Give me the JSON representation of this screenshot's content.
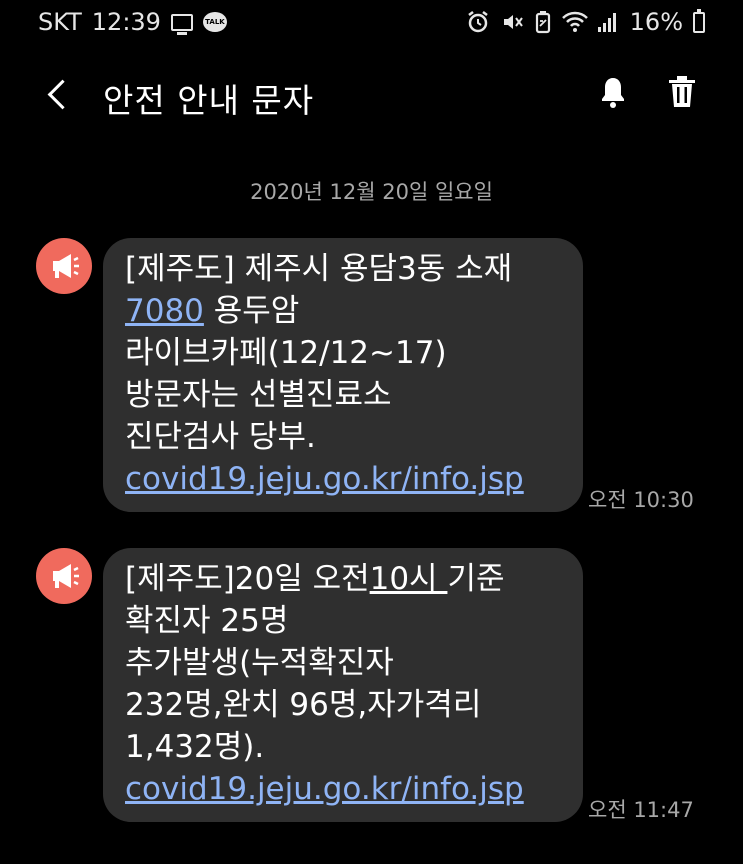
{
  "status_bar": {
    "carrier": "SKT",
    "time": "12:39",
    "talk_badge": "TALK",
    "battery": "16%"
  },
  "header": {
    "title": "안전 안내 문자"
  },
  "date": "2020년 12월 20일 일요일",
  "messages": [
    {
      "time": "오전 10:30",
      "line1": "[제주도] 제주시 용담3동 소재",
      "phone": "7080",
      "line2_rest": " 용두암",
      "line3": "라이브카페(12/12~17)",
      "line4": "방문자는 선별진료소",
      "line5": "진단검사 당부.",
      "link": "covid19.jeju.go.kr/info.jsp"
    },
    {
      "time": "오전 11:47",
      "line1_prefix": "[제주도]20일 오전",
      "line1_underlined": "10시 ",
      "line1_suffix": "기준",
      "line2": "확진자 25명",
      "line3": "추가발생(누적확진자",
      "line4": "232명,완치 96명,자가격리",
      "line5": "1,432명).",
      "link": "covid19.jeju.go.kr/info.jsp"
    }
  ],
  "colors": {
    "background": "#000000",
    "bubble": "#2f2f2f",
    "avatar": "#f06a5d",
    "link": "#8fb4f5",
    "meta_text": "#a8a8a8"
  },
  "icons": {
    "back": "chevron-left-icon",
    "bell": "bell-icon",
    "trash": "trash-icon",
    "avatar": "megaphone-icon"
  }
}
